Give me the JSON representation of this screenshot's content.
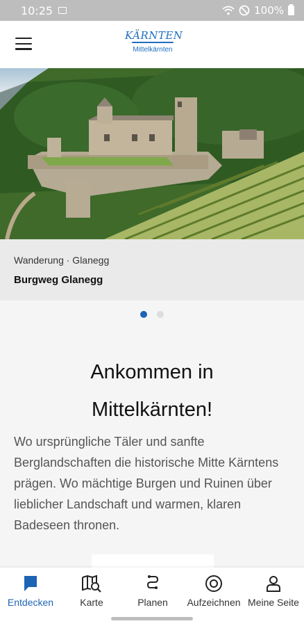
{
  "status_bar": {
    "time": "10:25",
    "battery": "100%"
  },
  "app_bar": {
    "logo_text": "KÄRNTEN",
    "region": "Mittelkärnten"
  },
  "carousel": {
    "meta": "Wanderung · Glanegg",
    "title": "Burgweg Glanegg",
    "pages": 2,
    "active_page": 1
  },
  "intro": {
    "headline": "Ankommen in Mittelkärnten!",
    "text": "Wo ursprüngliche Täler und sanfte Berglandschaften die historische Mitte Kärntens prägen. Wo mächtige Burgen und Ruinen über lieblicher Landschaft und warmen, klaren Badeseen thronen."
  },
  "bottom_nav": {
    "items": [
      {
        "label": "Entdecken",
        "icon": "chat-bubble-icon",
        "active": true
      },
      {
        "label": "Karte",
        "icon": "map-search-icon",
        "active": false
      },
      {
        "label": "Planen",
        "icon": "route-icon",
        "active": false
      },
      {
        "label": "Aufzeichnen",
        "icon": "record-icon",
        "active": false
      },
      {
        "label": "Meine Seite",
        "icon": "person-icon",
        "active": false
      }
    ]
  },
  "colors": {
    "accent": "#1e64b4",
    "logo": "#1f6fc0"
  }
}
